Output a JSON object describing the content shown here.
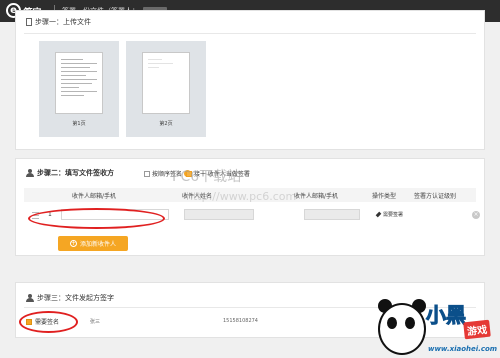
{
  "header": {
    "logo_mark": "e",
    "logo_text": "签宝",
    "title": "签署一份文件（签署人："
  },
  "step1": {
    "title": "步骤一：上传文件",
    "pages": [
      {
        "label": "第1页"
      },
      {
        "label": "第2页"
      }
    ]
  },
  "step2": {
    "title": "步骤二：填写文件签收方",
    "option_order": "按顺序签名",
    "option_self": "接十 收件人当做签署",
    "table": {
      "headers": [
        "收件人邮箱/手机",
        "收件人姓名",
        "收件人邮箱/手机",
        "操作类型",
        "签署方认证级别"
      ],
      "row": {
        "index": "1",
        "email_value": "",
        "name_value": "",
        "mobile_value": "",
        "action": "需要签署",
        "delete_symbol": "×"
      }
    },
    "add_button": "添加新收件人",
    "add_symbol": "+"
  },
  "step3": {
    "title": "步骤三：文件发起方签字",
    "sign_label": "需要签名",
    "signer_name": "张三",
    "signer_phone": "15158108274"
  },
  "watermark": {
    "text": "PC6下载站",
    "url": "http://www.pc6.com"
  },
  "corner_brand": {
    "big": "小黑",
    "tag": "游戏",
    "url": "www.xiaohei.com"
  }
}
